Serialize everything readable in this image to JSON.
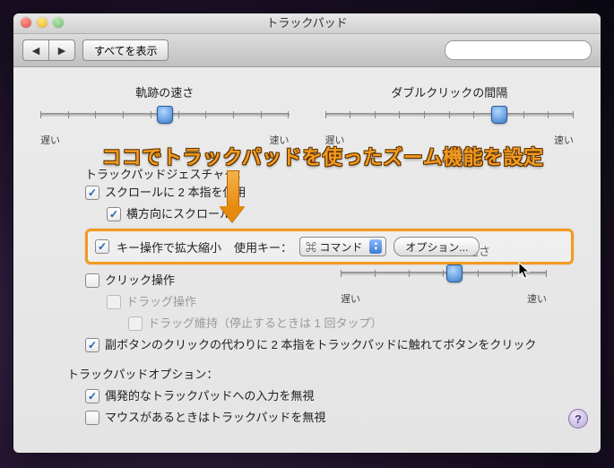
{
  "window": {
    "title": "トラックパッド"
  },
  "toolbar": {
    "back_glyph": "◀",
    "forward_glyph": "▶",
    "show_all": "すべてを表示",
    "search_placeholder": ""
  },
  "sliders": {
    "tracking": {
      "label": "軌跡の速さ",
      "min_label": "遅い",
      "max_label": "速い",
      "position_pct": 50
    },
    "doubleclick": {
      "label": "ダブルクリックの間隔",
      "min_label": "遅い",
      "max_label": "速い",
      "position_pct": 70
    },
    "scroll": {
      "label": "スクロールの速さ",
      "min_label": "遅い",
      "max_label": "速い",
      "position_pct": 55
    }
  },
  "gestures": {
    "section_title": "トラックパッドジェスチャー：",
    "two_finger_scroll": {
      "label": "スクロールに 2 本指を使用",
      "checked": true
    },
    "horizontal_scroll": {
      "label": "横方向にスクロール",
      "checked": true
    },
    "zoom": {
      "label": "キー操作で拡大縮小",
      "checked": true,
      "key_label": "使用キー：",
      "key_value": "⌘ コマンド",
      "options_button": "オプション..."
    },
    "click": {
      "label": "クリック操作",
      "checked": false
    },
    "drag": {
      "label": "ドラッグ操作",
      "checked": false
    },
    "drag_lock": {
      "label": "ドラッグ維持（停止するときは 1 回タップ）",
      "checked": false
    },
    "secondary_click": {
      "label": "副ボタンのクリックの代わりに 2 本指をトラックパッドに触れてボタンをクリック",
      "checked": true
    }
  },
  "options": {
    "section_title": "トラックパッドオプション：",
    "ignore_accidental": {
      "label": "偶発的なトラックパッドへの入力を無視",
      "checked": true
    },
    "ignore_when_mouse": {
      "label": "マウスがあるときはトラックパッドを無視",
      "checked": false
    }
  },
  "annotation": {
    "text": "ココでトラックパッドを使ったズーム機能を設定"
  },
  "help_glyph": "?"
}
